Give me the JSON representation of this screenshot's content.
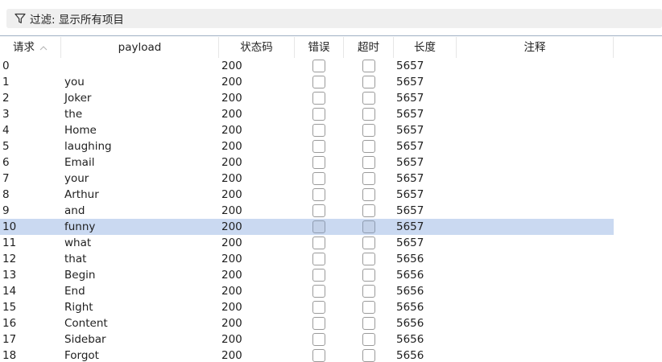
{
  "filter": {
    "label": "过滤: 显示所有项目"
  },
  "columns": {
    "request": "请求",
    "payload": "payload",
    "status": "状态码",
    "error": "错误",
    "timeout": "超时",
    "length": "长度",
    "comment": "注释"
  },
  "sort": {
    "column": "request",
    "direction": "ascending"
  },
  "selected_row_index": 10,
  "rows": [
    {
      "request": "0",
      "payload": "",
      "status": "200",
      "error": false,
      "timeout": false,
      "length": "5657",
      "comment": ""
    },
    {
      "request": "1",
      "payload": "you",
      "status": "200",
      "error": false,
      "timeout": false,
      "length": "5657",
      "comment": ""
    },
    {
      "request": "2",
      "payload": "Joker",
      "status": "200",
      "error": false,
      "timeout": false,
      "length": "5657",
      "comment": ""
    },
    {
      "request": "3",
      "payload": "the",
      "status": "200",
      "error": false,
      "timeout": false,
      "length": "5657",
      "comment": ""
    },
    {
      "request": "4",
      "payload": "Home",
      "status": "200",
      "error": false,
      "timeout": false,
      "length": "5657",
      "comment": ""
    },
    {
      "request": "5",
      "payload": "laughing",
      "status": "200",
      "error": false,
      "timeout": false,
      "length": "5657",
      "comment": ""
    },
    {
      "request": "6",
      "payload": "Email",
      "status": "200",
      "error": false,
      "timeout": false,
      "length": "5657",
      "comment": ""
    },
    {
      "request": "7",
      "payload": "your",
      "status": "200",
      "error": false,
      "timeout": false,
      "length": "5657",
      "comment": ""
    },
    {
      "request": "8",
      "payload": "Arthur",
      "status": "200",
      "error": false,
      "timeout": false,
      "length": "5657",
      "comment": ""
    },
    {
      "request": "9",
      "payload": "and",
      "status": "200",
      "error": false,
      "timeout": false,
      "length": "5657",
      "comment": ""
    },
    {
      "request": "10",
      "payload": "funny",
      "status": "200",
      "error": false,
      "timeout": false,
      "length": "5657",
      "comment": ""
    },
    {
      "request": "11",
      "payload": "what",
      "status": "200",
      "error": false,
      "timeout": false,
      "length": "5657",
      "comment": ""
    },
    {
      "request": "12",
      "payload": "that",
      "status": "200",
      "error": false,
      "timeout": false,
      "length": "5656",
      "comment": ""
    },
    {
      "request": "13",
      "payload": "Begin",
      "status": "200",
      "error": false,
      "timeout": false,
      "length": "5656",
      "comment": ""
    },
    {
      "request": "14",
      "payload": "End",
      "status": "200",
      "error": false,
      "timeout": false,
      "length": "5656",
      "comment": ""
    },
    {
      "request": "15",
      "payload": "Right",
      "status": "200",
      "error": false,
      "timeout": false,
      "length": "5656",
      "comment": ""
    },
    {
      "request": "16",
      "payload": "Content",
      "status": "200",
      "error": false,
      "timeout": false,
      "length": "5656",
      "comment": ""
    },
    {
      "request": "17",
      "payload": "Sidebar",
      "status": "200",
      "error": false,
      "timeout": false,
      "length": "5656",
      "comment": ""
    },
    {
      "request": "18",
      "payload": "Forgot",
      "status": "200",
      "error": false,
      "timeout": false,
      "length": "5656",
      "comment": ""
    }
  ],
  "colors": {
    "selected_row": "#cad9f1",
    "filter_bg": "#efefef",
    "header_line": "#9fb0c4"
  },
  "icons": {
    "filter": "funnel-icon",
    "sort": "chevron-up-icon"
  }
}
